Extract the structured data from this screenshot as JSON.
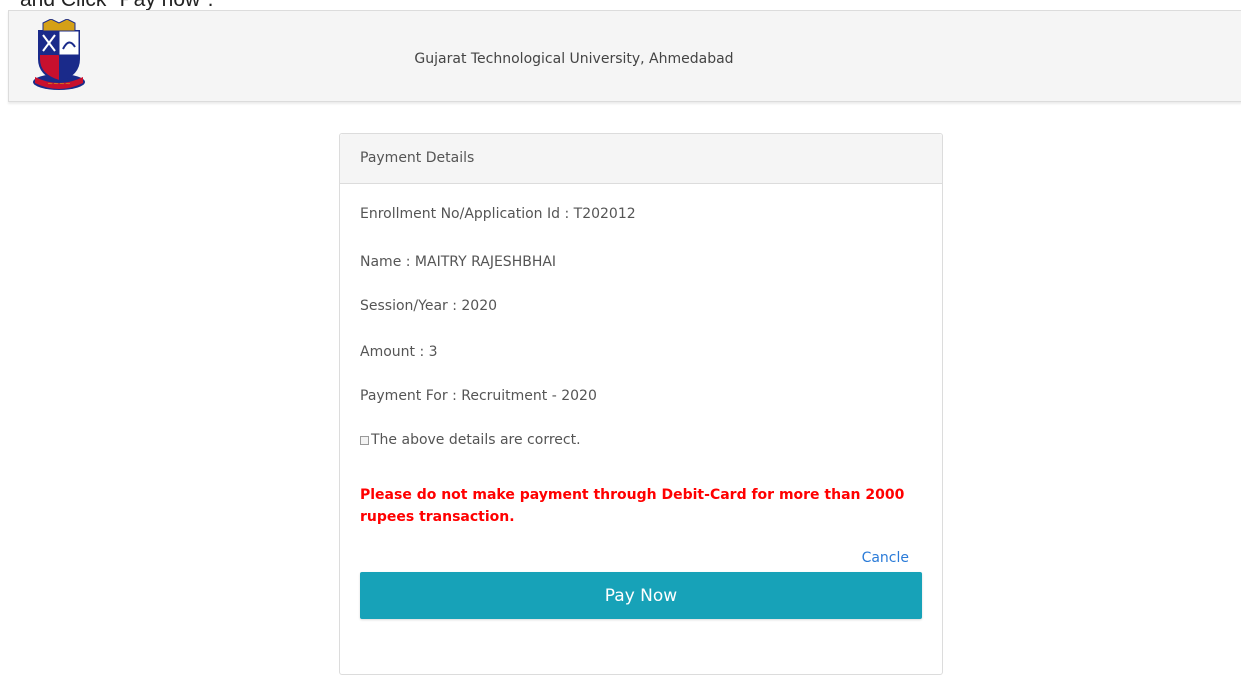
{
  "caption": "and Click \"Pay now\".",
  "header": {
    "university": "Gujarat Technological University, Ahmedabad",
    "logo_icon": "gtu-crest-logo"
  },
  "panel": {
    "title": "Payment Details",
    "enrollment": "Enrollment No/Application Id : T202012",
    "name": "Name : MAITRY RAJESHBHAI",
    "session": "Session/Year : 2020",
    "amount": "Amount : 3",
    "payment_for": "Payment For : Recruitment - 2020",
    "confirm_label": "The above details are correct.",
    "confirm_checked": false,
    "warning": "Please do not make payment through Debit-Card for more than 2000 rupees transaction.",
    "cancel_label": "Cancle",
    "pay_label": "Pay Now"
  },
  "colors": {
    "pay_button": "#17a2b8",
    "warning": "#ff0000",
    "link": "#2a7bd8"
  }
}
